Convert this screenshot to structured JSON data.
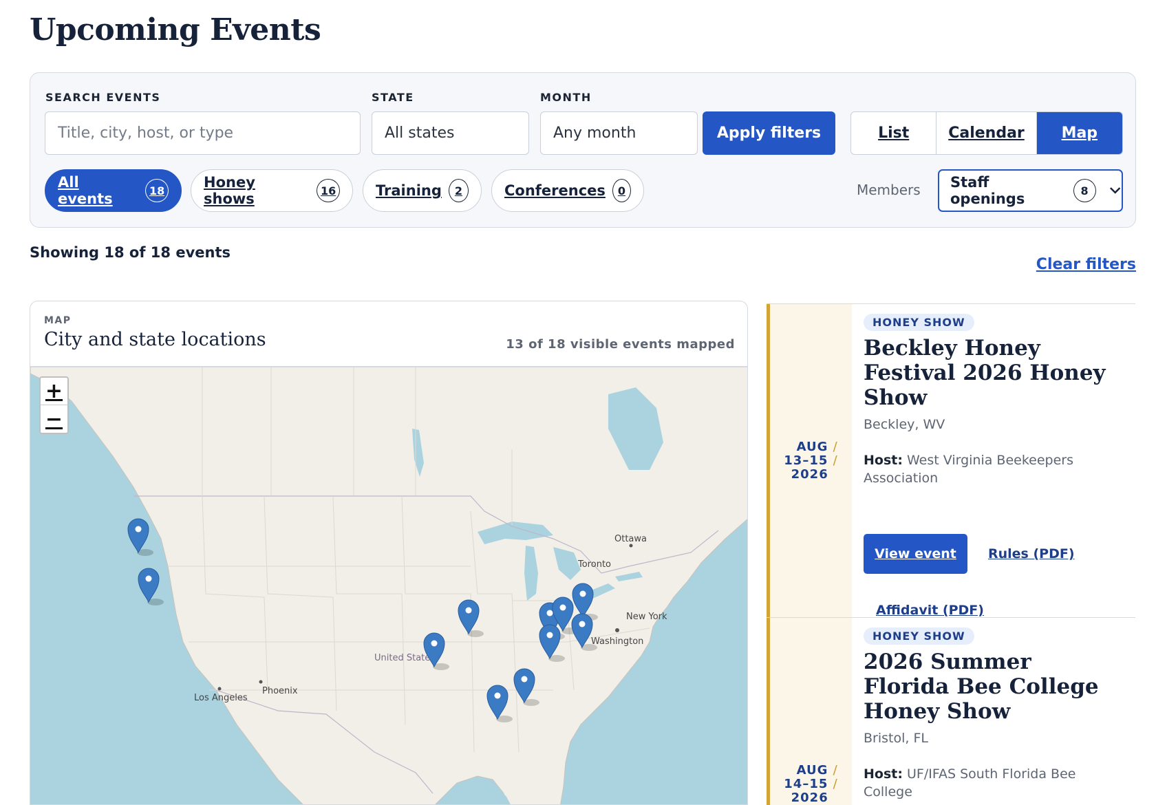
{
  "page": {
    "title": "Upcoming Events"
  },
  "filters": {
    "search_label": "SEARCH EVENTS",
    "search_placeholder": "Title, city, host, or type",
    "state_label": "STATE",
    "state_value": "All states",
    "month_label": "MONTH",
    "month_value": "Any month",
    "apply_label": "Apply filters",
    "views": [
      "List",
      "Calendar",
      "Map"
    ],
    "active_view": "Map",
    "chips": [
      {
        "label": "All events",
        "count": "18",
        "active": true
      },
      {
        "label": "Honey shows",
        "count": "16",
        "active": false
      },
      {
        "label": "Training",
        "count": "2",
        "active": false
      },
      {
        "label": "Conferences",
        "count": "0",
        "active": false
      }
    ],
    "members_label": "Members",
    "staff_label": "Staff openings",
    "staff_count": "8"
  },
  "results": {
    "showing_text": "Showing 18 of 18 events",
    "clear_label": "Clear filters"
  },
  "map": {
    "eyebrow": "MAP",
    "title": "City and state locations",
    "mapped_count": "13 of 18 visible events mapped",
    "zoom_in": "+",
    "zoom_out": "−",
    "place_labels": [
      "Ottawa",
      "Toronto",
      "New York",
      "Washington",
      "United States",
      "Phoenix",
      "Los Angeles"
    ],
    "marker_count": 13,
    "colors": {
      "water": "#aad3df",
      "land": "#f2efe9",
      "marker": "#3b7bc4"
    }
  },
  "events": [
    {
      "type": "HONEY SHOW",
      "title": "Beckley Honey Festival 2026 Honey Show",
      "location": "Beckley, WV",
      "host_label": "Host:",
      "host": "West Virginia Beekeepers Association",
      "date_month": "AUG",
      "date_days": "13–15",
      "date_year": "2026",
      "view_label": "View event",
      "rules_label": "Rules (PDF)",
      "affidavit_label": "Affidavit (PDF)"
    },
    {
      "type": "HONEY SHOW",
      "title": "2026 Summer Florida Bee College Honey Show",
      "location": "Bristol, FL",
      "host_label": "Host:",
      "host": "UF/IFAS South Florida Bee College",
      "date_month": "AUG",
      "date_days": "14–15",
      "date_year": "2026"
    }
  ],
  "colors": {
    "accent": "#2457c5",
    "date_bg": "#fcf6e8",
    "date_bar": "#d2a33a",
    "badge_bg": "#e6eefb"
  }
}
